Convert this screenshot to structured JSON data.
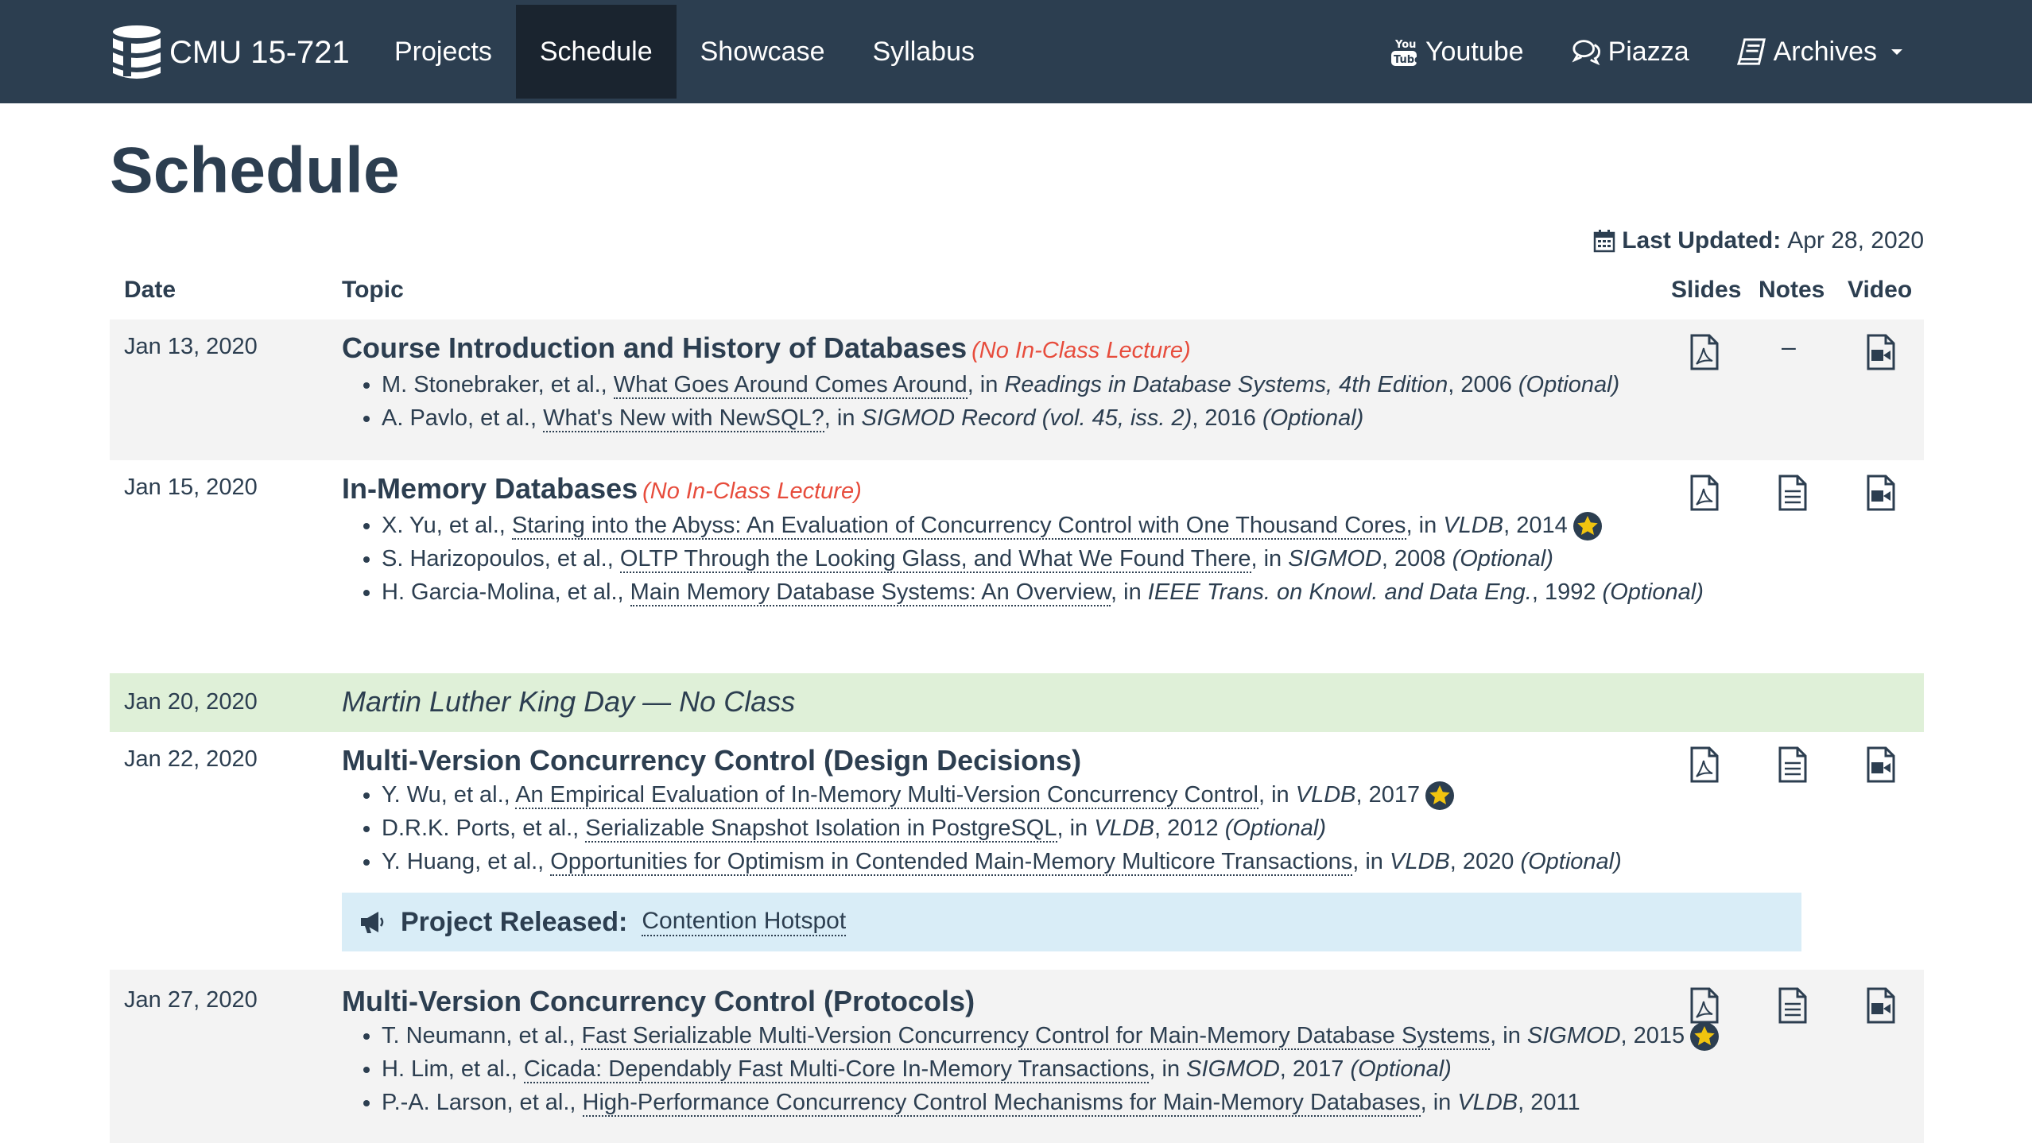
{
  "navbar": {
    "brand": "CMU 15-721",
    "items": [
      {
        "label": "Projects"
      },
      {
        "label": "Schedule"
      },
      {
        "label": "Showcase"
      },
      {
        "label": "Syllabus"
      }
    ],
    "right": [
      {
        "label": "Youtube",
        "icon": "youtube-icon"
      },
      {
        "label": "Piazza",
        "icon": "comments-icon"
      },
      {
        "label": "Archives",
        "icon": "book-icon"
      }
    ]
  },
  "page": {
    "title": "Schedule",
    "last_updated_label": "Last Updated:",
    "last_updated_value": "Apr 28, 2020"
  },
  "table": {
    "headers": {
      "date": "Date",
      "topic": "Topic",
      "slides": "Slides",
      "notes": "Notes",
      "video": "Video"
    },
    "rows": [
      {
        "date": "Jan 13, 2020",
        "title": "Course Introduction and History of Databases",
        "note": "(No In-Class Lecture)",
        "notes_placeholder": "–",
        "readings": [
          {
            "authors": "M. Stonebraker, et al., ",
            "paper": "What Goes Around Comes Around",
            "in": ", in ",
            "venue": "Readings in Database Systems, 4th Edition",
            "year": ", 2006 ",
            "optional": "(Optional)"
          },
          {
            "authors": "A. Pavlo, et al., ",
            "paper": "What's New with NewSQL?",
            "in": ", in ",
            "venue": "SIGMOD Record (vol. 45, iss. 2)",
            "year": ", 2016 ",
            "optional": "(Optional)"
          }
        ]
      },
      {
        "date": "Jan 15, 2020",
        "title": "In-Memory Databases",
        "note": "(No In-Class Lecture)",
        "readings": [
          {
            "authors": "X. Yu, et al., ",
            "paper": "Staring into the Abyss: An Evaluation of Concurrency Control with One Thousand Cores",
            "in": ", in ",
            "venue": "VLDB",
            "year": ", 2014",
            "optional": ""
          },
          {
            "authors": "S. Harizopoulos, et al., ",
            "paper": "OLTP Through the Looking Glass, and What We Found There",
            "in": ", in ",
            "venue": "SIGMOD",
            "year": ", 2008 ",
            "optional": "(Optional)"
          },
          {
            "authors": "H. Garcia-Molina, et al., ",
            "paper": "Main Memory Database Systems: An Overview",
            "in": ", in ",
            "venue": "IEEE Trans. on Knowl. and Data Eng.",
            "year": ", 1992 ",
            "optional": "(Optional)"
          }
        ]
      },
      {
        "date": "Jan 20, 2020",
        "holiday": "Martin Luther King Day — No Class"
      },
      {
        "date": "Jan 22, 2020",
        "title": "Multi-Version Concurrency Control (Design Decisions)",
        "readings": [
          {
            "authors": "Y. Wu, et al., ",
            "paper": "An Empirical Evaluation of In-Memory Multi-Version Concurrency Control",
            "in": ", in ",
            "venue": "VLDB",
            "year": ", 2017",
            "optional": ""
          },
          {
            "authors": "D.R.K. Ports, et al., ",
            "paper": "Serializable Snapshot Isolation in PostgreSQL",
            "in": ", in ",
            "venue": "VLDB",
            "year": ", 2012 ",
            "optional": "(Optional)"
          },
          {
            "authors": "Y. Huang, et al., ",
            "paper": "Opportunities for Optimism in Contended Main-Memory Multicore Transactions",
            "in": ", in ",
            "venue": "VLDB",
            "year": ", 2020 ",
            "optional": "(Optional)"
          }
        ],
        "announcement": {
          "label": "Project Released:",
          "link": "Contention Hotspot"
        }
      },
      {
        "date": "Jan 27, 2020",
        "title": "Multi-Version Concurrency Control (Protocols)",
        "readings": [
          {
            "authors": "T. Neumann, et al., ",
            "paper": "Fast Serializable Multi-Version Concurrency Control for Main-Memory Database Systems",
            "in": ", in ",
            "venue": "SIGMOD",
            "year": ", 2015",
            "optional": ""
          },
          {
            "authors": "H. Lim, et al., ",
            "paper": "Cicada: Dependably Fast Multi-Core In-Memory Transactions",
            "in": ", in ",
            "venue": "SIGMOD",
            "year": ", 2017 ",
            "optional": "(Optional)"
          },
          {
            "authors": "P.-A. Larson, et al., ",
            "paper": "High-Performance Concurrency Control Mechanisms for Main-Memory Databases",
            "in": ", in ",
            "venue": "VLDB",
            "year": ", 2011",
            "optional": ""
          }
        ]
      }
    ]
  },
  "colors": {
    "navbar": "#2c3e50",
    "navbar_active": "#1a242f",
    "note_red": "#e74c3c",
    "row_shaded": "#f3f3f3",
    "holiday_green": "#dff0d8",
    "announce_blue": "#d9edf7",
    "star_yellow": "#f1c40f"
  }
}
